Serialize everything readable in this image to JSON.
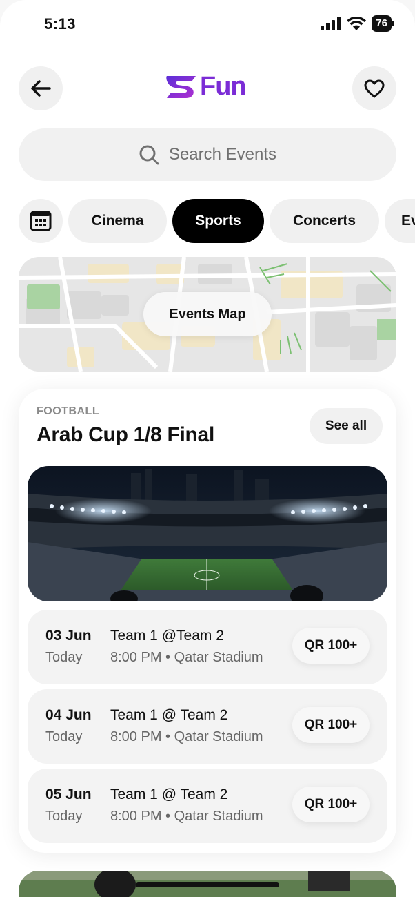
{
  "status_bar": {
    "time": "5:13",
    "battery": "76"
  },
  "header": {
    "logo_text": "Fun",
    "back_icon": "arrow-left-icon",
    "favorite_icon": "heart-icon"
  },
  "search": {
    "placeholder": "Search Events"
  },
  "categories": {
    "items": [
      {
        "label": "Cinema",
        "active": false
      },
      {
        "label": "Sports",
        "active": true
      },
      {
        "label": "Concerts",
        "active": false
      },
      {
        "label": "Ev",
        "active": false
      }
    ]
  },
  "map": {
    "button_label": "Events Map"
  },
  "event": {
    "category": "FOOTBALL",
    "title": "Arab Cup 1/8 Final",
    "see_all": "See all",
    "rows": [
      {
        "date": "03 Jun",
        "day": "Today",
        "teams": "Team 1 @Team 2",
        "info": "8:00 PM • Qatar Stadium",
        "price": "QR 100+"
      },
      {
        "date": "04 Jun",
        "day": "Today",
        "teams": "Team 1 @ Team 2",
        "info": "8:00 PM • Qatar Stadium",
        "price": "QR 100+"
      },
      {
        "date": "05 Jun",
        "day": "Today",
        "teams": "Team 1 @ Team 2",
        "info": "8:00 PM • Qatar Stadium",
        "price": "QR 100+"
      }
    ]
  },
  "colors": {
    "brand": "#7b2cd6",
    "active_chip": "#000000"
  }
}
